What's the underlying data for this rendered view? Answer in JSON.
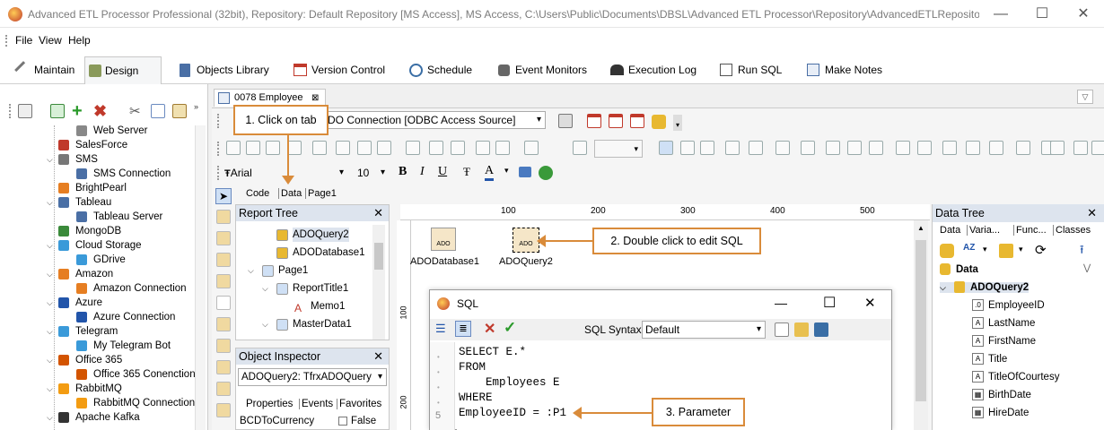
{
  "window": {
    "title": "Advanced ETL Processor Professional (32bit), Repository: Default Repository  [MS Access], MS Access, C:\\Users\\Public\\Documents\\DBSL\\Advanced ETL Processor\\Repository\\AdvancedETLRepository....",
    "minimize": "—",
    "maximize": "☐",
    "close": "✕"
  },
  "menu": {
    "file": "File",
    "view": "View",
    "help": "Help"
  },
  "tabs": [
    "Maintain",
    "Design",
    "Objects Library",
    "Version Control",
    "Schedule",
    "Event Monitors",
    "Execution Log",
    "Run SQL",
    "Make Notes"
  ],
  "sidebar": {
    "items": [
      "Web Server",
      "SalesForce",
      "SMS",
      "SMS Connection",
      "BrightPearl",
      "Tableau",
      "Tableau Server",
      "MongoDB",
      "Cloud Storage",
      "GDrive",
      "Amazon",
      "Amazon Connection",
      "Azure",
      "Azure Connection",
      "Telegram",
      "My Telegram Bot",
      "Office 365",
      "Office 365 Conenction",
      "RabbitMQ",
      "RabbitMQ Connection",
      "Apache Kafka"
    ]
  },
  "document": {
    "tab_label": "0078 Employee",
    "connection": "ADO Connection [ODBC Access Source]",
    "font_name": "Arial",
    "font_size": "10",
    "subtabs": [
      "Code",
      "Data",
      "Page1"
    ]
  },
  "report_tree": {
    "title": "Report Tree",
    "items": [
      "ADOQuery2",
      "ADODatabase1",
      "Page1",
      "ReportTitle1",
      "Memo1",
      "MasterData1"
    ]
  },
  "object_inspector": {
    "title": "Object Inspector",
    "selected": "ADOQuery2: TfrxADOQuery",
    "tabs": [
      "Properties",
      "Events",
      "Favorites"
    ],
    "prop_name": "BCDToCurrency",
    "prop_value": "False"
  },
  "ruler": {
    "t100": "100",
    "t200": "200",
    "t300": "300",
    "t400": "400",
    "t500": "500",
    "v100": "100",
    "v200": "200"
  },
  "canvas": {
    "db_label": "ADODatabase1",
    "query_label": "ADOQuery2",
    "db_icon": "ADO",
    "query_icon": "ADO"
  },
  "callouts": {
    "c1": "1. Click on tab",
    "c2": "2. Double click to edit SQL",
    "c3": "3. Parameter"
  },
  "sql_window": {
    "title": "SQL",
    "syntax_label": "SQL Syntax:",
    "syntax_value": "Default",
    "lines": [
      "SELECT E.*",
      "FROM",
      "    Employees E",
      "WHERE",
      "EmployeeID = :P1"
    ],
    "line5_no": "5"
  },
  "data_tree": {
    "title": "Data Tree",
    "tabs": [
      "Data",
      "Varia...",
      "Func...",
      "Classes"
    ],
    "root": "Data",
    "query": "ADOQuery2",
    "fields": [
      "EmployeeID",
      "LastName",
      "FirstName",
      "Title",
      "TitleOfCourtesy",
      "BirthDate",
      "HireDate"
    ]
  },
  "colors": {
    "accent": "#d98b3a",
    "panel_header": "#dde4ee"
  }
}
